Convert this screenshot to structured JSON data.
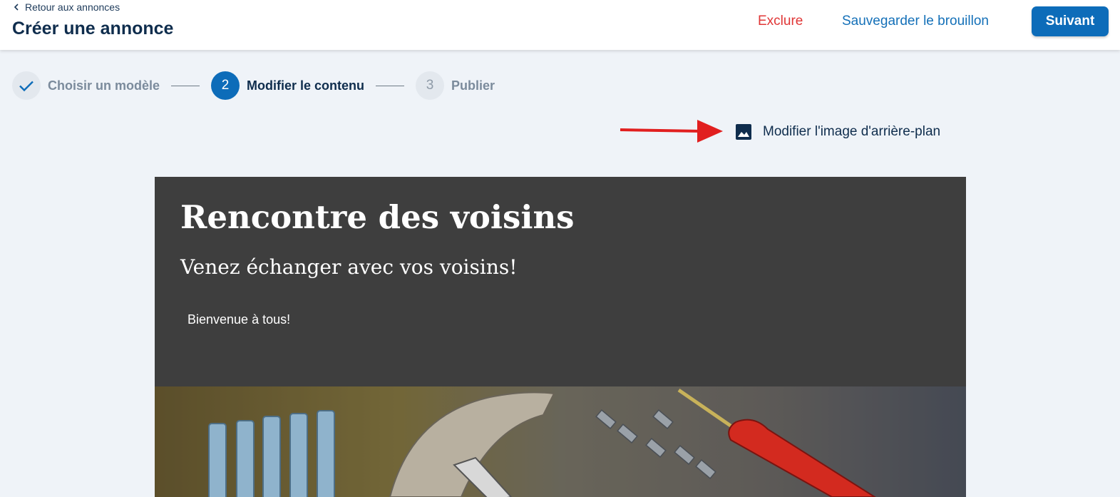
{
  "header": {
    "back_label": "Retour aux annonces",
    "title": "Créer une annonce",
    "exclude_label": "Exclure",
    "save_draft_label": "Sauvegarder le brouillon",
    "next_label": "Suivant"
  },
  "stepper": {
    "steps": [
      {
        "number": "",
        "label": "Choisir un modèle",
        "state": "done"
      },
      {
        "number": "2",
        "label": "Modifier le contenu",
        "state": "active"
      },
      {
        "number": "3",
        "label": "Publier",
        "state": "todo"
      }
    ]
  },
  "editor": {
    "change_background_label": "Modifier l'image d'arrière-plan"
  },
  "preview": {
    "title": "Rencontre des voisins",
    "subtitle": "Venez échanger avec vos voisins!",
    "body": "Bienvenue à tous!"
  },
  "colors": {
    "primary": "#0d6cb9",
    "danger": "#e03636",
    "page_bg": "#eff3f8",
    "preview_bg": "#3e3e3e"
  }
}
